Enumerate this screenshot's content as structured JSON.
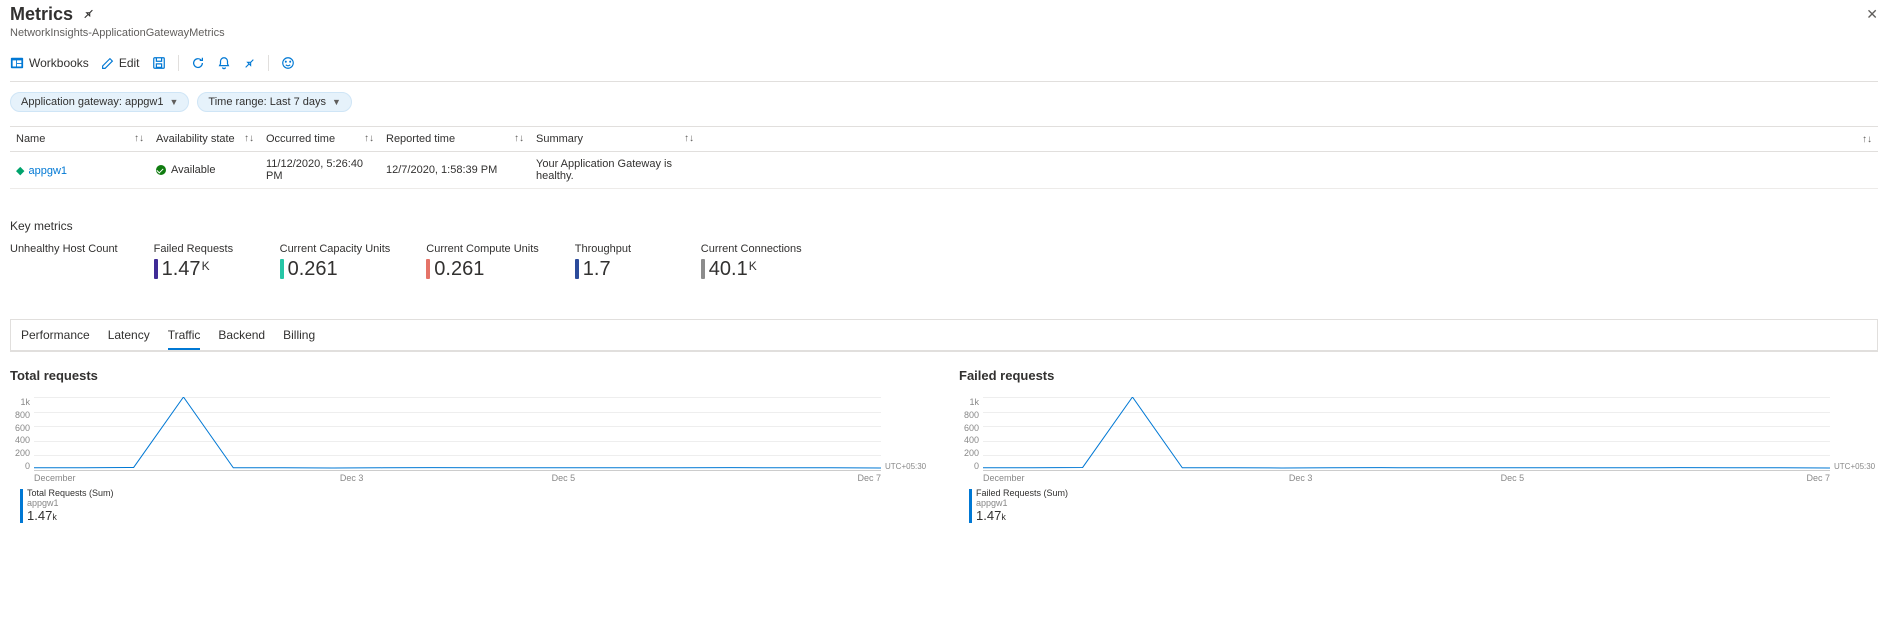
{
  "header": {
    "title": "Metrics",
    "subtitle": "NetworkInsights-ApplicationGatewayMetrics"
  },
  "toolbar": {
    "workbooks": "Workbooks",
    "edit": "Edit"
  },
  "filters": {
    "gateway": "Application gateway: appgw1",
    "timerange": "Time range: Last 7 days"
  },
  "table": {
    "cols": [
      "Name",
      "Availability state",
      "Occurred time",
      "Reported time",
      "Summary",
      ""
    ],
    "rows": [
      {
        "name": "appgw1",
        "state": "Available",
        "occurred": "11/12/2020, 5:26:40 PM",
        "reported": "12/7/2020, 1:58:39 PM",
        "summary": "Your Application Gateway is healthy."
      }
    ]
  },
  "keymetrics": {
    "heading": "Key metrics",
    "items": [
      {
        "label": "Unhealthy Host Count",
        "value": "",
        "suffix": "",
        "color": "#4fc3f7"
      },
      {
        "label": "Failed Requests",
        "value": "1.47",
        "suffix": "K",
        "color": "#3f2b96"
      },
      {
        "label": "Current Capacity Units",
        "value": "0.261",
        "suffix": "",
        "color": "#26c6a6"
      },
      {
        "label": "Current Compute Units",
        "value": "0.261",
        "suffix": "",
        "color": "#e57368"
      },
      {
        "label": "Throughput",
        "value": "1.7",
        "suffix": "",
        "color": "#2b4b9b"
      },
      {
        "label": "Current Connections",
        "value": "40.1",
        "suffix": "K",
        "color": "#8c8c8c"
      }
    ]
  },
  "tabs": [
    "Performance",
    "Latency",
    "Traffic",
    "Backend",
    "Billing"
  ],
  "active_tab": "Traffic",
  "chart_data": [
    {
      "type": "line",
      "title": "Total requests",
      "ylim": [
        0,
        1000
      ],
      "yticks": [
        "1k",
        "800",
        "600",
        "400",
        "200",
        "0"
      ],
      "xticks": [
        "December",
        "Dec 3",
        "Dec 5",
        "Dec 7"
      ],
      "tz": "UTC+05:30",
      "series": [
        {
          "name": "Total Requests (Sum)",
          "resource": "appgw1",
          "x": [
            0,
            1,
            2,
            3,
            4,
            5,
            6,
            7,
            8,
            9,
            10,
            11,
            12,
            13,
            14,
            15,
            16,
            17
          ],
          "values": [
            30,
            30,
            35,
            1000,
            30,
            30,
            28,
            30,
            32,
            30,
            30,
            30,
            30,
            30,
            32,
            30,
            30,
            28
          ]
        }
      ],
      "legend_value": "1.47",
      "legend_suffix": "k"
    },
    {
      "type": "line",
      "title": "Failed requests",
      "ylim": [
        0,
        1000
      ],
      "yticks": [
        "1k",
        "800",
        "600",
        "400",
        "200",
        "0"
      ],
      "xticks": [
        "December",
        "Dec 3",
        "Dec 5",
        "Dec 7"
      ],
      "tz": "UTC+05:30",
      "series": [
        {
          "name": "Failed Requests (Sum)",
          "resource": "appgw1",
          "x": [
            0,
            1,
            2,
            3,
            4,
            5,
            6,
            7,
            8,
            9,
            10,
            11,
            12,
            13,
            14,
            15,
            16,
            17
          ],
          "values": [
            30,
            30,
            35,
            1000,
            30,
            30,
            28,
            30,
            32,
            30,
            30,
            30,
            30,
            30,
            32,
            30,
            30,
            28
          ]
        }
      ],
      "legend_value": "1.47",
      "legend_suffix": "k"
    }
  ]
}
